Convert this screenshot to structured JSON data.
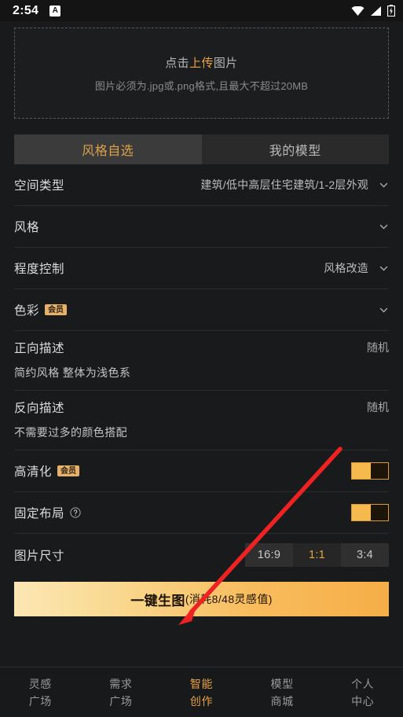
{
  "statusbar": {
    "time": "2:54",
    "app_icon_letter": "A",
    "icons": [
      "wifi-icon",
      "signal-icon",
      "battery-charging-icon"
    ]
  },
  "upload": {
    "title_prefix": "点击",
    "title_highlight": "上传",
    "title_suffix": "图片",
    "subtitle": "图片必须为.jpg或.png格式,且最大不超过20MB",
    "highlight_color": "#e8a33d"
  },
  "tabs": [
    {
      "label": "风格自选",
      "active": true
    },
    {
      "label": "我的模型",
      "active": false
    }
  ],
  "form": {
    "space_type": {
      "label": "空间类型",
      "value": "建筑/低中高层住宅建筑/1-2层外观"
    },
    "style": {
      "label": "风格",
      "value": ""
    },
    "degree_control": {
      "label": "程度控制",
      "value": "风格改造"
    },
    "color": {
      "label": "色彩",
      "badge": "会员",
      "value": ""
    },
    "positive_prompt": {
      "label": "正向描述",
      "action": "随机",
      "text": "简约风格  整体为浅色系"
    },
    "negative_prompt": {
      "label": "反向描述",
      "action": "随机",
      "text": "不需要过多的颜色搭配"
    },
    "hd": {
      "label": "高清化",
      "badge": "会员",
      "enabled": true
    },
    "fixed_layout": {
      "label": "固定布局",
      "help": "?",
      "enabled": true
    },
    "image_size": {
      "label": "图片尺寸",
      "options": [
        "16:9",
        "1:1",
        "3:4"
      ],
      "selected": "1:1"
    }
  },
  "cta": {
    "main": "一键生图",
    "sub": "(消耗8/48灵感值)",
    "accent": "#f6ae46"
  },
  "bottomnav": [
    {
      "line1": "灵感",
      "line2": "广场",
      "active": false
    },
    {
      "line1": "需求",
      "line2": "广场",
      "active": false
    },
    {
      "line1": "智能",
      "line2": "创作",
      "active": true
    },
    {
      "line1": "模型",
      "line2": "商城",
      "active": false
    },
    {
      "line1": "个人",
      "line2": "中心",
      "active": false
    }
  ],
  "annotation": {
    "type": "arrow",
    "color": "#ee2222"
  }
}
